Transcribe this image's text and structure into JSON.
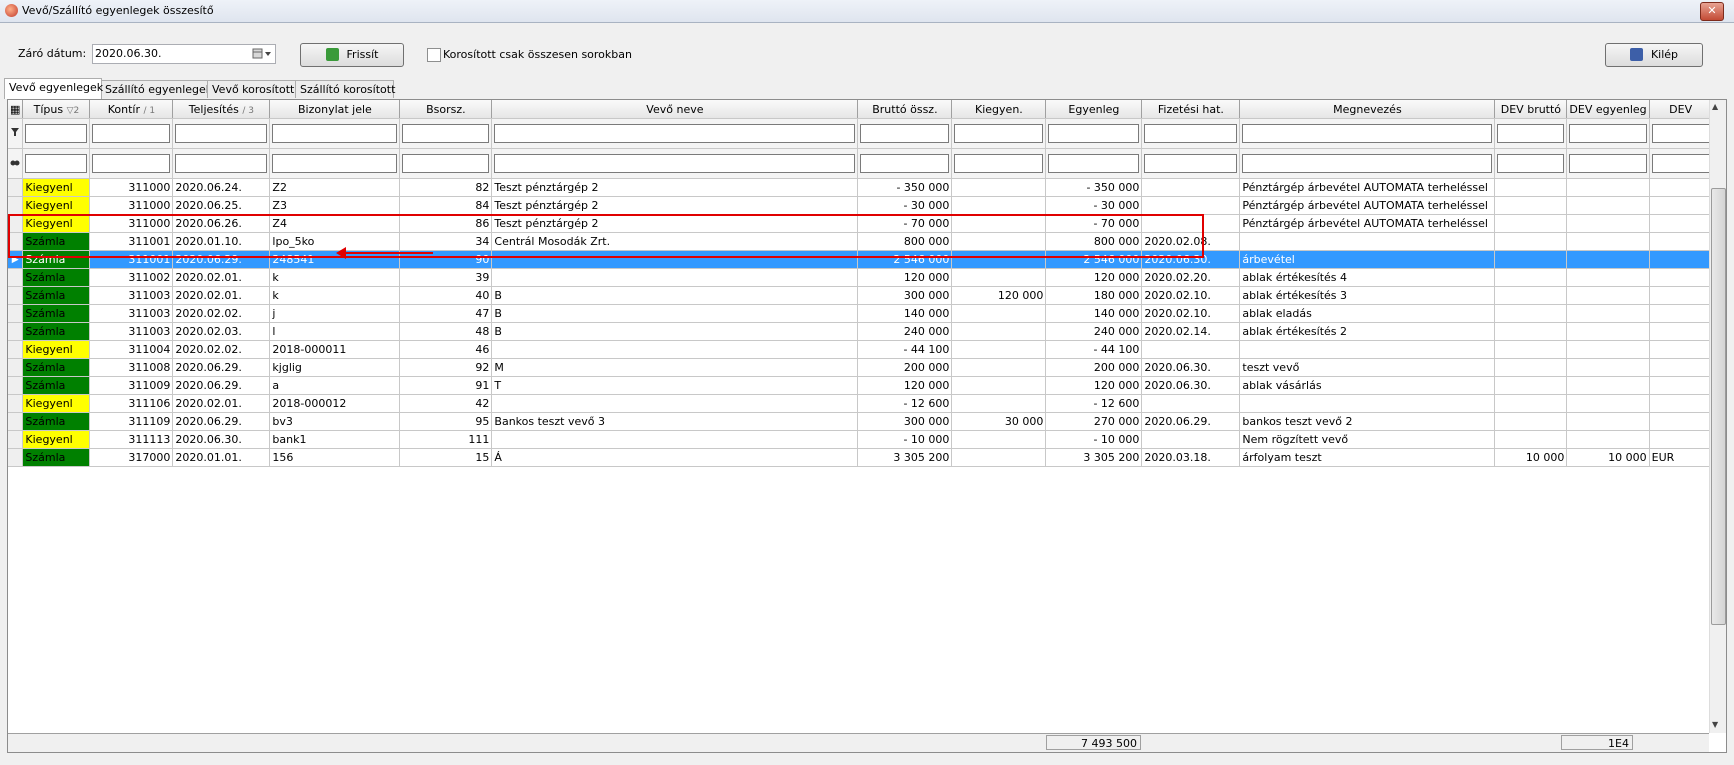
{
  "window": {
    "title": "Vevő/Szállító egyenlegek összesítő",
    "close_symbol": "✕"
  },
  "toolbar": {
    "date_label": "Záró dátum:",
    "date_value": "2020.06.30.",
    "refresh_label": "Frissít",
    "checkbox_label": "Korosított csak összesen sorokban",
    "exit_label": "Kilép"
  },
  "tabs": [
    "Vevő egyenlegek",
    "Szállító egyenlegek",
    "Vevő korosított",
    "Szállító korosított"
  ],
  "columns": [
    "Típus",
    "Kontír",
    "Teljesítés",
    "Bizonylat jele",
    "Bsorsz.",
    "Vevő neve",
    "Bruttó össz.",
    "Kiegyen.",
    "Egyenleg",
    "Fizetési hat.",
    "Megnevezés",
    "DEV bruttó",
    "DEV egyenleg",
    "DEV"
  ],
  "sort_markers": {
    "tipus": "▽2",
    "kontir": "/ 1",
    "teljesites": "/ 3"
  },
  "rows": [
    {
      "type": "Kiegyenl",
      "kontir": "311000",
      "telj": "2020.06.24.",
      "biz": "Z2",
      "bsorsz": "82",
      "vevo": "Teszt pénztárgép 2",
      "brutto": "- 350 000",
      "kiegy": "",
      "egyenleg": "- 350 000",
      "fiz": "",
      "megn": "Pénztárgép árbevétel AUTOMATA terheléssel",
      "devb": "",
      "deve": "",
      "dev": ""
    },
    {
      "type": "Kiegyenl",
      "kontir": "311000",
      "telj": "2020.06.25.",
      "biz": "Z3",
      "bsorsz": "84",
      "vevo": "Teszt pénztárgép 2",
      "brutto": "- 30 000",
      "kiegy": "",
      "egyenleg": "- 30 000",
      "fiz": "",
      "megn": "Pénztárgép árbevétel AUTOMATA terheléssel",
      "devb": "",
      "deve": "",
      "dev": ""
    },
    {
      "type": "Kiegyenl",
      "kontir": "311000",
      "telj": "2020.06.26.",
      "biz": "Z4",
      "bsorsz": "86",
      "vevo": "Teszt pénztárgép 2",
      "brutto": "- 70 000",
      "kiegy": "",
      "egyenleg": "- 70 000",
      "fiz": "",
      "megn": "Pénztárgép árbevétel AUTOMATA terheléssel",
      "devb": "",
      "deve": "",
      "dev": ""
    },
    {
      "type": "Számla",
      "kontir": "311001",
      "telj": "2020.01.10.",
      "biz": "lpo_5ko",
      "bsorsz": "34",
      "vevo": "Centrál Mosodák Zrt.",
      "brutto": "800 000",
      "kiegy": "",
      "egyenleg": "800 000",
      "fiz": "2020.02.08.",
      "megn": "",
      "devb": "",
      "deve": "",
      "dev": ""
    },
    {
      "type": "Számla",
      "kontir": "311001",
      "telj": "2020.06.29.",
      "biz": "248541",
      "bsorsz": "90",
      "vevo": "",
      "brutto": "2 546 000",
      "kiegy": "",
      "egyenleg": "2 546 000",
      "fiz": "2020.06.30.",
      "megn": "árbevétel",
      "devb": "",
      "deve": "",
      "dev": "",
      "selected": true
    },
    {
      "type": "Számla",
      "kontir": "311002",
      "telj": "2020.02.01.",
      "biz": "k",
      "bsorsz": "39",
      "vevo": "",
      "brutto": "120 000",
      "kiegy": "",
      "egyenleg": "120 000",
      "fiz": "2020.02.20.",
      "megn": "ablak értékesítés 4",
      "devb": "",
      "deve": "",
      "dev": ""
    },
    {
      "type": "Számla",
      "kontir": "311003",
      "telj": "2020.02.01.",
      "biz": "k",
      "bsorsz": "40",
      "vevo": "B",
      "brutto": "300 000",
      "kiegy": "120 000",
      "egyenleg": "180 000",
      "fiz": "2020.02.10.",
      "megn": "ablak értékesítés 3",
      "devb": "",
      "deve": "",
      "dev": ""
    },
    {
      "type": "Számla",
      "kontir": "311003",
      "telj": "2020.02.02.",
      "biz": "j",
      "bsorsz": "47",
      "vevo": "B",
      "brutto": "140 000",
      "kiegy": "",
      "egyenleg": "140 000",
      "fiz": "2020.02.10.",
      "megn": "ablak eladás",
      "devb": "",
      "deve": "",
      "dev": ""
    },
    {
      "type": "Számla",
      "kontir": "311003",
      "telj": "2020.02.03.",
      "biz": "l",
      "bsorsz": "48",
      "vevo": "B",
      "brutto": "240 000",
      "kiegy": "",
      "egyenleg": "240 000",
      "fiz": "2020.02.14.",
      "megn": "ablak értékesítés 2",
      "devb": "",
      "deve": "",
      "dev": ""
    },
    {
      "type": "Kiegyenl",
      "kontir": "311004",
      "telj": "2020.02.02.",
      "biz": "2018-000011",
      "bsorsz": "46",
      "vevo": "",
      "brutto": "- 44 100",
      "kiegy": "",
      "egyenleg": "- 44 100",
      "fiz": "",
      "megn": "",
      "devb": "",
      "deve": "",
      "dev": ""
    },
    {
      "type": "Számla",
      "kontir": "311008",
      "telj": "2020.06.29.",
      "biz": "kjglig",
      "bsorsz": "92",
      "vevo": "M",
      "brutto": "200 000",
      "kiegy": "",
      "egyenleg": "200 000",
      "fiz": "2020.06.30.",
      "megn": "teszt vevő",
      "devb": "",
      "deve": "",
      "dev": ""
    },
    {
      "type": "Számla",
      "kontir": "311009",
      "telj": "2020.06.29.",
      "biz": "a",
      "bsorsz": "91",
      "vevo": "T",
      "brutto": "120 000",
      "kiegy": "",
      "egyenleg": "120 000",
      "fiz": "2020.06.30.",
      "megn": "ablak vásárlás",
      "devb": "",
      "deve": "",
      "dev": ""
    },
    {
      "type": "Kiegyenl",
      "kontir": "311106",
      "telj": "2020.02.01.",
      "biz": "2018-000012",
      "bsorsz": "42",
      "vevo": "",
      "brutto": "- 12 600",
      "kiegy": "",
      "egyenleg": "- 12 600",
      "fiz": "",
      "megn": "",
      "devb": "",
      "deve": "",
      "dev": ""
    },
    {
      "type": "Számla",
      "kontir": "311109",
      "telj": "2020.06.29.",
      "biz": "bv3",
      "bsorsz": "95",
      "vevo": "Bankos teszt vevő 3",
      "brutto": "300 000",
      "kiegy": "30 000",
      "egyenleg": "270 000",
      "fiz": "2020.06.29.",
      "megn": "bankos teszt vevő 2",
      "devb": "",
      "deve": "",
      "dev": ""
    },
    {
      "type": "Kiegyenl",
      "kontir": "311113",
      "telj": "2020.06.30.",
      "biz": "bank1",
      "bsorsz": "111",
      "vevo": "",
      "brutto": "- 10 000",
      "kiegy": "",
      "egyenleg": "- 10 000",
      "fiz": "",
      "megn": "Nem rögzített vevő",
      "devb": "",
      "deve": "",
      "dev": ""
    },
    {
      "type": "Számla",
      "kontir": "317000",
      "telj": "2020.01.01.",
      "biz": "156",
      "bsorsz": "15",
      "vevo": "Á",
      "brutto": "3 305 200",
      "kiegy": "",
      "egyenleg": "3 305 200",
      "fiz": "2020.03.18.",
      "megn": "árfolyam teszt",
      "devb": "10 000",
      "deve": "10 000",
      "dev": "EUR"
    }
  ],
  "footer": {
    "egyenleg_total": "7 493 500",
    "dev_egyenleg_total": "1E4"
  },
  "colors": {
    "kiegyenl": "#ffff00",
    "szamla": "#008000",
    "selection": "#3399ff",
    "highlight": "#e00000"
  }
}
